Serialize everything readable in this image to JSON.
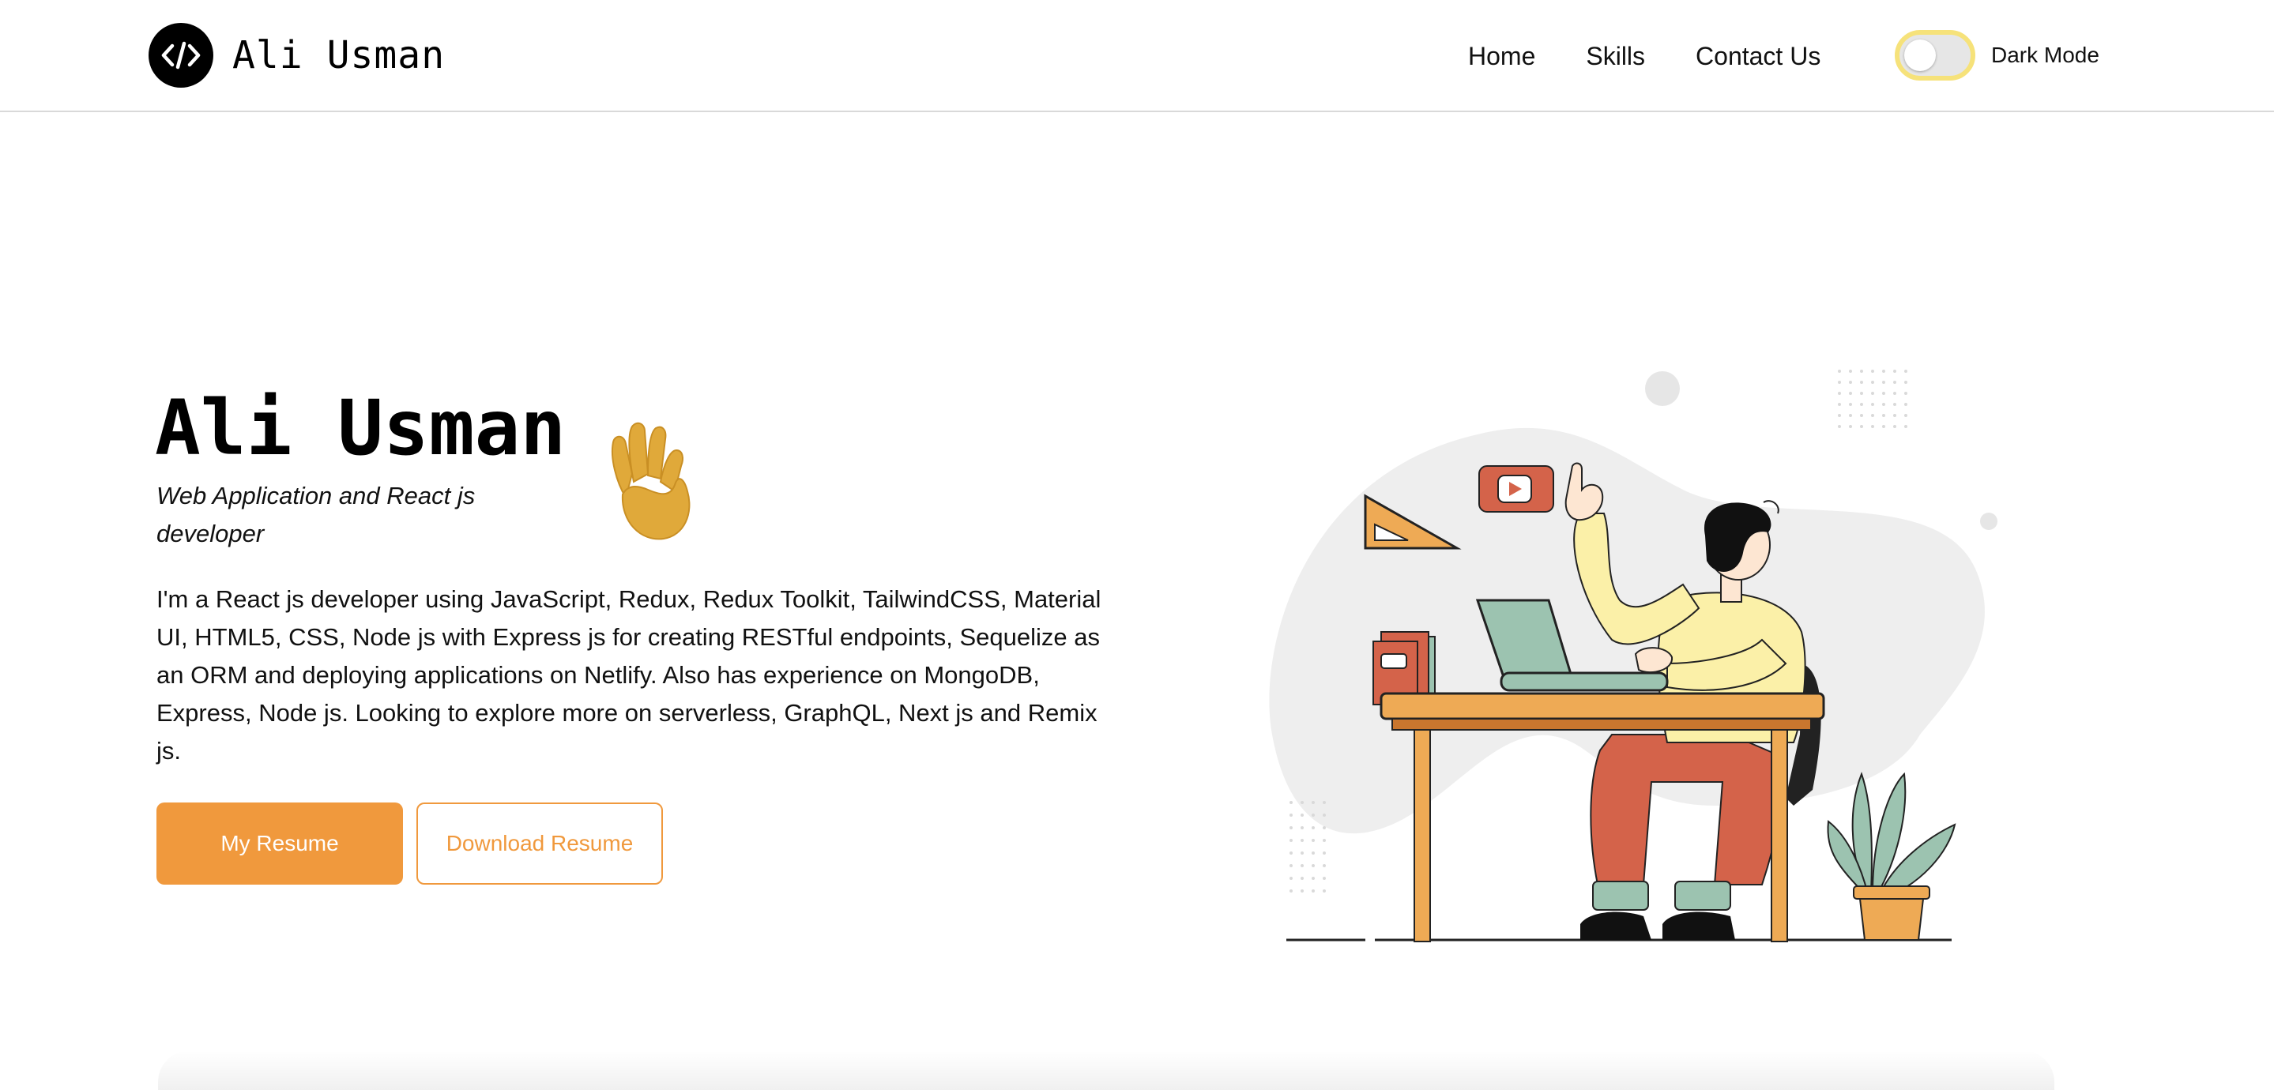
{
  "header": {
    "logo_icon": "code-icon",
    "brand": "Ali Usman",
    "nav": [
      {
        "label": "Home"
      },
      {
        "label": "Skills"
      },
      {
        "label": "Contact Us"
      }
    ],
    "dark_mode_label": "Dark Mode",
    "dark_mode_on": false
  },
  "hero": {
    "name": "Ali Usman",
    "wave_icon": "waving-hand-icon",
    "tagline": "Web Application and React js developer",
    "bio": "I'm a React js developer using JavaScript, Redux, Redux Toolkit, TailwindCSS, Material UI, HTML5, CSS, Node js with Express js for creating RESTful endpoints, Sequelize as an ORM and deploying applications on Netlify. Also has experience on MongoDB, Express, Node js. Looking to explore more on serverless, GraphQL, Next js and Remix js.",
    "primary_button": "My Resume",
    "secondary_button": "Download Resume"
  },
  "colors": {
    "accent": "#f0993d",
    "toggle_border": "#f6e27a",
    "blob": "#eeeeee"
  }
}
